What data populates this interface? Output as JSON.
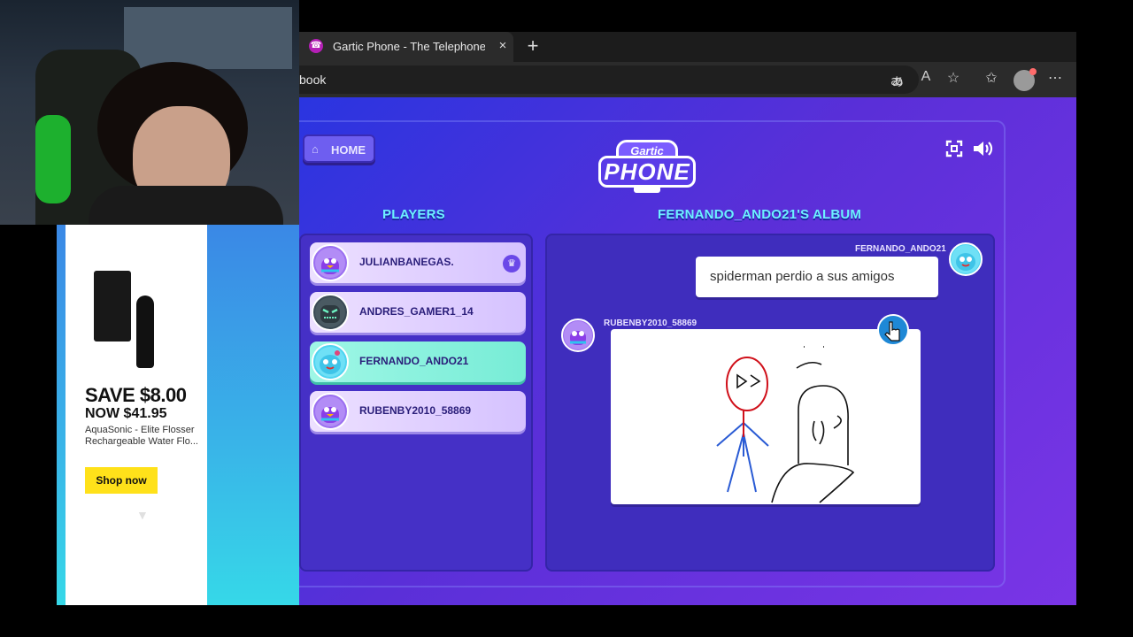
{
  "browser": {
    "tab_title": "Gartic Phone - The Telephone Ga",
    "tab_favicon": "☎",
    "tab_close": "×",
    "new_tab": "+",
    "address": "book",
    "icons": [
      "read-aloud-icon",
      "text-format-icon",
      "favorite-star-icon",
      "favorites-icon",
      "profile-icon",
      "more-menu-icon"
    ]
  },
  "game": {
    "home_label": "HOME",
    "logo_top": "Gartic",
    "logo_bottom": "PHONE",
    "players_title": "PLAYERS",
    "album_title": "FERNANDO_ANDO21'S ALBUM",
    "players": [
      {
        "name": "JULIANBANEGAS.",
        "host": true,
        "active": false
      },
      {
        "name": "ANDRES_GAMER1_14",
        "host": false,
        "active": false
      },
      {
        "name": "FERNANDO_ANDO21",
        "host": false,
        "active": true
      },
      {
        "name": "RUBENBY2010_58869",
        "host": false,
        "active": false
      }
    ],
    "album": {
      "entries": [
        {
          "author": "FERNANDO_ANDO21",
          "type": "text",
          "text": "spiderman perdio a sus amigos"
        },
        {
          "author": "RUBENBY2010_58869",
          "type": "drawing"
        }
      ]
    },
    "colors": {
      "accent": "#6df0ff",
      "active_player": "#77ecd6",
      "panel": "#4530c6"
    }
  },
  "ad": {
    "save": "SAVE $8.00",
    "now": "NOW $41.95",
    "description": "AquaSonic - Elite Flosser Rechargeable Water Flo...",
    "cta": "Shop now",
    "cta_color": "#ffe11a"
  }
}
